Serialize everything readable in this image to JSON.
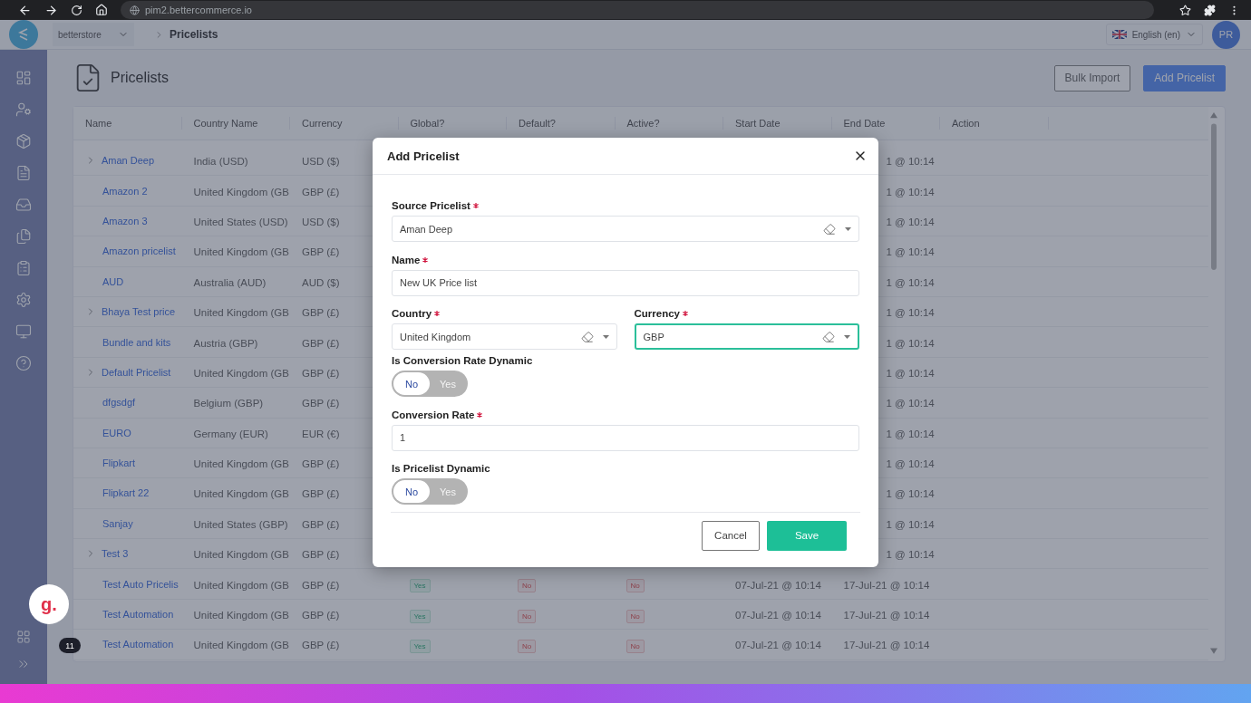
{
  "browser": {
    "url": "pim2.bettercommerce.io"
  },
  "header": {
    "store": "betterstore",
    "breadcrumb": "Pricelists",
    "language": "English (en)",
    "avatar": "PR"
  },
  "page": {
    "title": "Pricelists",
    "buttons": [
      {
        "label": "Bulk Import",
        "kind": "outline"
      },
      {
        "label": "Add Pricelist",
        "kind": "primary"
      }
    ]
  },
  "table": {
    "columns": [
      "Name",
      "Country Name",
      "Currency",
      "Global?",
      "Default?",
      "Active?",
      "Start Date",
      "End Date",
      "Action"
    ],
    "rows": [
      {
        "name": "Aman Deep",
        "expandable": true,
        "country": "India (USD)",
        "currency": "USD ($)",
        "end_date": "1 @ 10:14"
      },
      {
        "name": "Amazon 2",
        "expandable": false,
        "country": "United Kingdom (GB",
        "currency": "GBP (£)",
        "end_date": "1 @ 10:14"
      },
      {
        "name": "Amazon 3",
        "expandable": false,
        "country": "United States (USD)",
        "currency": "USD ($)",
        "end_date": "1 @ 10:14"
      },
      {
        "name": "Amazon pricelist",
        "expandable": false,
        "country": "United Kingdom (GB",
        "currency": "GBP (£)",
        "end_date": "1 @ 10:14"
      },
      {
        "name": "AUD",
        "expandable": false,
        "country": "Australia (AUD)",
        "currency": "AUD ($)",
        "end_date": "1 @ 10:14"
      },
      {
        "name": "Bhaya Test price",
        "expandable": true,
        "country": "United Kingdom (GB",
        "currency": "GBP (£)",
        "end_date": "1 @ 10:14"
      },
      {
        "name": "Bundle and kits",
        "expandable": false,
        "country": "Austria (GBP)",
        "currency": "GBP (£)",
        "end_date": "1 @ 10:14"
      },
      {
        "name": "Default Pricelist",
        "expandable": true,
        "country": "United Kingdom (GB",
        "currency": "GBP (£)",
        "end_date": "1 @ 10:14"
      },
      {
        "name": "dfgsdgf",
        "expandable": false,
        "country": "Belgium (GBP)",
        "currency": "GBP (£)",
        "end_date": "1 @ 10:14"
      },
      {
        "name": "EURO",
        "expandable": false,
        "country": "Germany (EUR)",
        "currency": "EUR (€)",
        "end_date": "1 @ 10:14"
      },
      {
        "name": "Flipkart",
        "expandable": false,
        "country": "United Kingdom (GB",
        "currency": "GBP (£)",
        "end_date": "1 @ 10:14"
      },
      {
        "name": "Flipkart 22",
        "expandable": false,
        "country": "United Kingdom (GB",
        "currency": "GBP (£)",
        "end_date": "1 @ 10:14"
      },
      {
        "name": "Sanjay",
        "expandable": false,
        "country": "United States (GBP)",
        "currency": "GBP (£)",
        "end_date": "1 @ 10:14"
      },
      {
        "name": "Test 3",
        "expandable": true,
        "country": "United Kingdom (GB",
        "currency": "GBP (£)",
        "end_date": "1 @ 10:14"
      },
      {
        "name": "Test Auto Pricelis",
        "expandable": false,
        "country": "United Kingdom (GB",
        "currency": "GBP (£)",
        "global": {
          "label": "Yes",
          "on": true
        },
        "default": {
          "label": "No",
          "on": false
        },
        "active": {
          "label": "No",
          "on": false
        },
        "start_date": "07-Jul-21 @ 10:14",
        "end_date": "17-Jul-21 @ 10:14"
      },
      {
        "name": "Test Automation",
        "expandable": false,
        "country": "United Kingdom (GB",
        "currency": "GBP (£)",
        "global": {
          "label": "Yes",
          "on": true
        },
        "default": {
          "label": "No",
          "on": false
        },
        "active": {
          "label": "No",
          "on": false
        },
        "start_date": "07-Jul-21 @ 10:14",
        "end_date": "17-Jul-21 @ 10:14"
      },
      {
        "name": "Test Automation",
        "expandable": false,
        "country": "United Kingdom (GB",
        "currency": "GBP (£)",
        "global": {
          "label": "Yes",
          "on": true
        },
        "default": {
          "label": "No",
          "on": false
        },
        "active": {
          "label": "No",
          "on": false
        },
        "start_date": "07-Jul-21 @ 10:14",
        "end_date": "17-Jul-21 @ 10:14"
      }
    ]
  },
  "modal": {
    "title": "Add Pricelist",
    "fields": [
      {
        "kind": "select",
        "label": "Source Pricelist",
        "required": true,
        "value": "Aman Deep",
        "focused": false
      },
      {
        "kind": "text",
        "label": "Name",
        "required": true,
        "value": "New UK Price list",
        "focused": false
      },
      {
        "kind": "pair",
        "fields": [
          {
            "kind": "select",
            "label": "Country",
            "required": true,
            "value": "United Kingdom",
            "focused": false
          },
          {
            "kind": "select",
            "label": "Currency",
            "required": true,
            "value": "GBP",
            "focused": true
          }
        ]
      },
      {
        "kind": "toggle",
        "label": "Is Conversion Rate Dynamic",
        "options": [
          {
            "label": "No",
            "selected": true
          },
          {
            "label": "Yes",
            "selected": false
          }
        ]
      },
      {
        "kind": "text",
        "label": "Conversion Rate",
        "required": true,
        "value": "1",
        "focused": false
      },
      {
        "kind": "toggle",
        "label": "Is Pricelist Dynamic",
        "options": [
          {
            "label": "No",
            "selected": true
          },
          {
            "label": "Yes",
            "selected": false
          }
        ]
      }
    ],
    "buttons": [
      {
        "label": "Cancel",
        "kind": "outline"
      },
      {
        "label": "Save",
        "kind": "primary"
      }
    ]
  },
  "widget": {
    "letter": "g.",
    "count": "11"
  }
}
